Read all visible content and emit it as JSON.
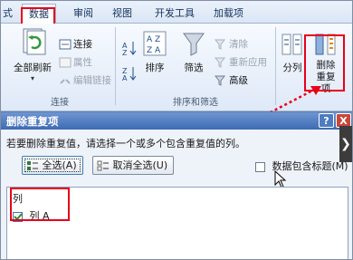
{
  "ribbon": {
    "tabs": [
      "式",
      "数据",
      "审阅",
      "视图",
      "开发工具",
      "加载项"
    ],
    "active_tab": "数据",
    "groups": {
      "connections": {
        "label": "连接",
        "refresh_all": "全部刷新",
        "connections": "连接",
        "properties": "属性",
        "edit_links": "编辑链接"
      },
      "sort_filter": {
        "label": "排序和筛选",
        "sort": "排序",
        "filter": "筛选",
        "clear": "清除",
        "reapply": "重新应用",
        "advanced": "高级"
      },
      "data_tools": {
        "split": "分列",
        "remove_duplicates": "删除重复项"
      }
    }
  },
  "dialog": {
    "title": "删除重复项",
    "help": "?",
    "close": "X",
    "description": "若要删除重复值，请选择一个或多个包含重复值的列。",
    "select_all": "全选(A)",
    "unselect_all": "取消全选(U)",
    "has_headers": "数据包含标题(M)",
    "has_headers_checked": false,
    "column_header": "列",
    "columns": [
      {
        "label": "列 A",
        "checked": true
      }
    ]
  },
  "colors": {
    "highlight": "#e8001a",
    "titlebar": "#4a76bb"
  }
}
